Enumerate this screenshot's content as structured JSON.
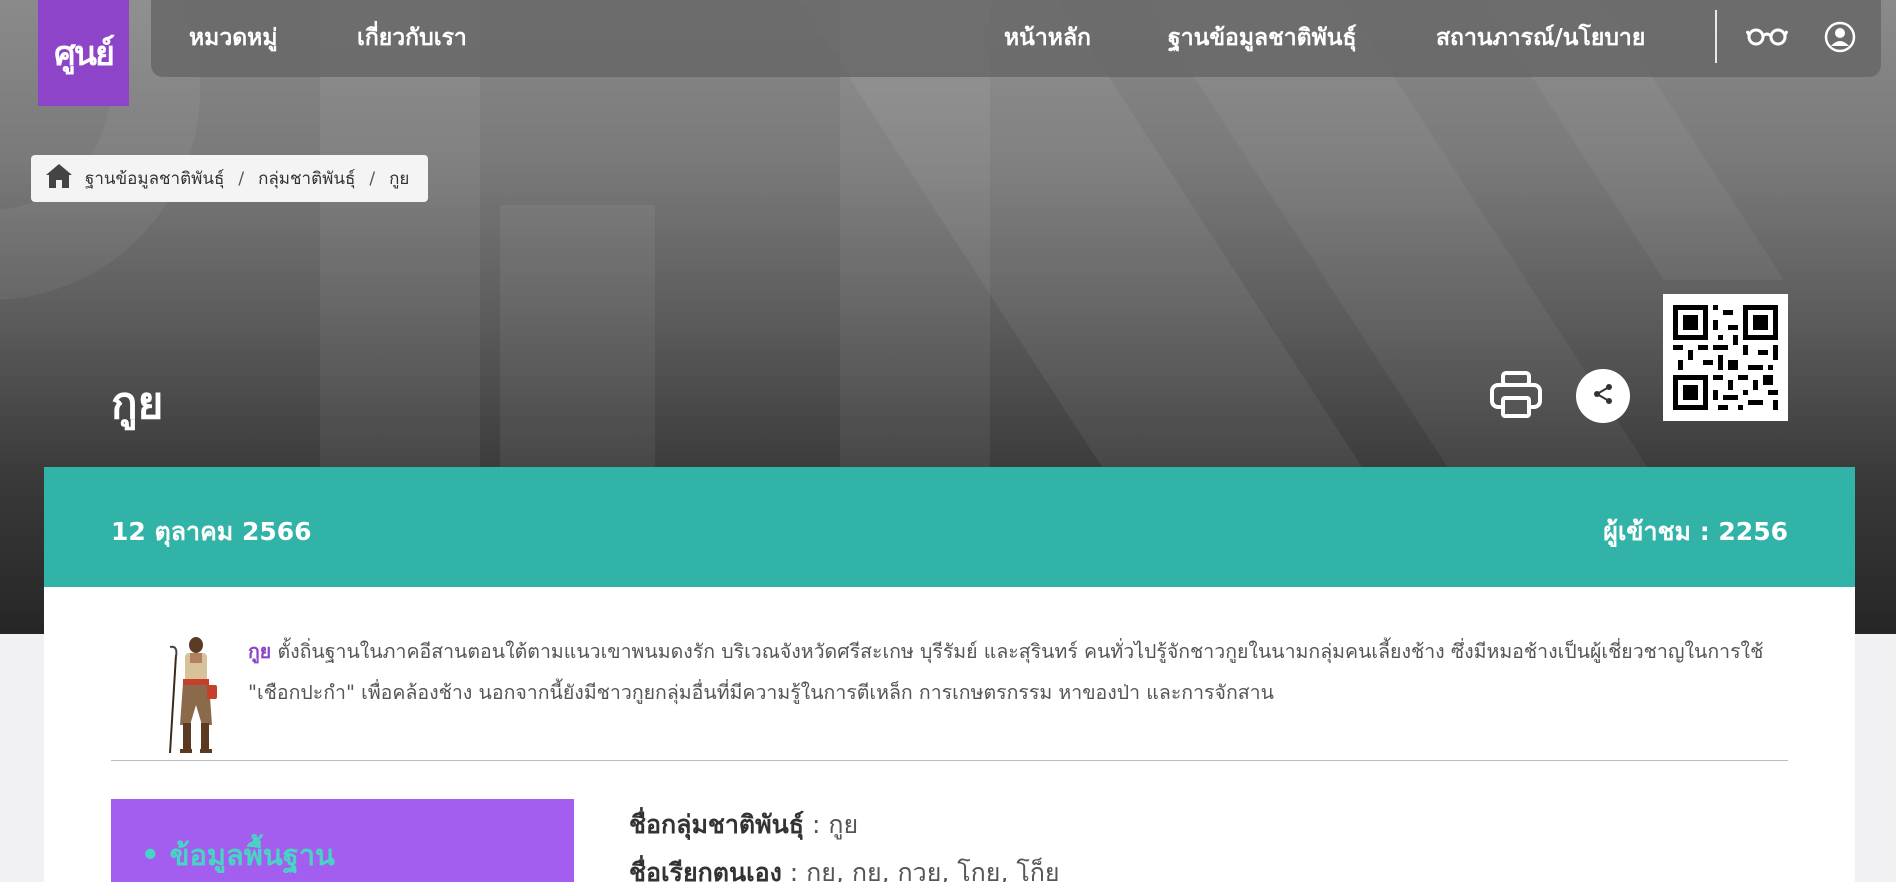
{
  "logo": {
    "text": "ศูนย์"
  },
  "nav": {
    "left_items": [
      "หมวดหมู่",
      "เกี่ยวกับเรา"
    ],
    "right_items": [
      "หน้าหลัก",
      "ฐานข้อมูลชาติพันธุ์",
      "สถานภารณ์/นโยบาย"
    ],
    "icons": [
      "glasses-icon",
      "user-circle-icon"
    ]
  },
  "breadcrumb": {
    "home_icon": "home-icon",
    "items": [
      "ฐานข้อมูลชาติพันธุ์",
      "กลุ่มชาติพันธุ์",
      "กูย"
    ],
    "separator": "/"
  },
  "page": {
    "title": "กูย",
    "date": "12 ตุลาคม 2566",
    "views_label": "ผู้เข้าชม : 2256"
  },
  "tools": {
    "print_icon": "printer-icon",
    "share_icon": "share-icon",
    "qr_icon": "qr-code"
  },
  "intro": {
    "highlight": "กูย",
    "text": "ตั้งถิ่นฐานในภาคอีสานตอนใต้ตามแนวเขาพนมดงรัก  บริเวณจังหวัดศรีสะเกษ บุรีรัมย์ และสุรินทร์ คนทั่วไปรู้จักชาวกูยในนามกลุ่มคนเลี้ยงช้าง ซึ่งมีหมอช้างเป็นผู้เชี่ยวชาญในการใช้ \"เชือกปะกำ\" เพื่อคล้องช้าง นอกจากนี้ยังมีชาวกูยกลุ่มอื่นที่มีความรู้ในการตีเหล็ก การเกษตรกรรม หาของป่า และการจักสาน"
  },
  "sidebar": {
    "items": [
      "ข้อมูลพื้นฐาน"
    ]
  },
  "fields": [
    {
      "label": "ชื่อกลุ่มชาติพันธุ์",
      "value": " : กูย"
    },
    {
      "label": "ชื่อเรียกตนเอง",
      "value": " : กุย, กูย, กวย, โกย, โก็ย"
    }
  ],
  "colors": {
    "purple": "#8e44c9",
    "teal": "#32b3a7",
    "sidebar": "#a35ef0",
    "sidebar_text": "#48d4c3"
  }
}
